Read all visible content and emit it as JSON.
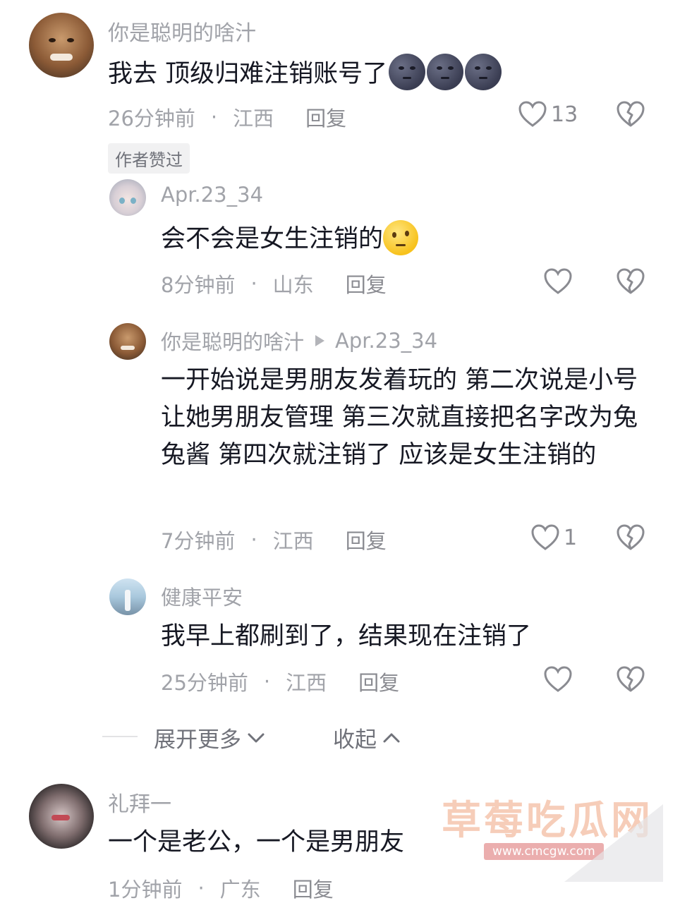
{
  "comments": [
    {
      "username": "你是聪明的啥汁",
      "text": "我去 顶级归难注销账号了",
      "time": "26分钟前",
      "location": "江西",
      "reply_label": "回复",
      "likes": "13",
      "badge": "作者赞过",
      "emoji": "new-moon-face x3"
    },
    {
      "username": "Apr.23_34",
      "text": "会不会是女生注销的",
      "time": "8分钟前",
      "location": "山东",
      "reply_label": "回复",
      "emoji": "thinking-face"
    },
    {
      "username": "你是聪明的啥汁",
      "reply_to": "Apr.23_34",
      "text": "一开始说是男朋友发着玩的 第二次说是小号让她男朋友管理 第三次就直接把名字改为兔兔酱 第四次就注销了 应该是女生注销的",
      "time": "7分钟前",
      "location": "江西",
      "reply_label": "回复",
      "likes": "1"
    },
    {
      "username": "健康平安",
      "text": "我早上都刷到了，结果现在注销了",
      "time": "25分钟前",
      "location": "江西",
      "reply_label": "回复"
    },
    {
      "username": "礼拜一",
      "text": "一个是老公，一个是男朋友",
      "time": "1分钟前",
      "location": "广东",
      "reply_label": "回复"
    }
  ],
  "controls": {
    "expand_more": "展开更多",
    "collapse": "收起"
  },
  "watermark": {
    "title": "草莓吃瓜网",
    "url": "www.cmcgw.com"
  },
  "colors": {
    "text": "#161823",
    "meta": "#a1a3a9",
    "icon": "#8a8b91"
  }
}
